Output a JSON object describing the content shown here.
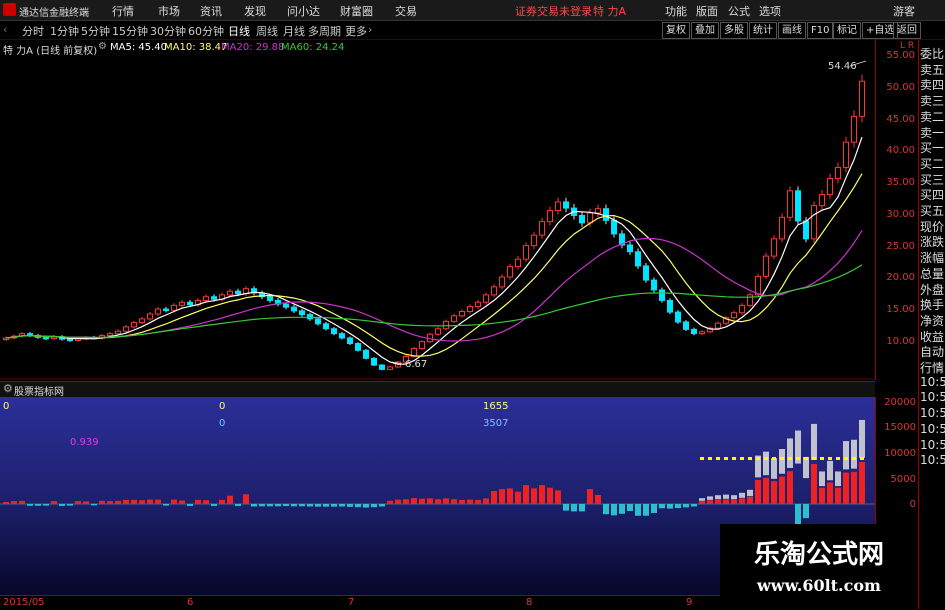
{
  "top_menu": {
    "app_title": "通达信金融终端",
    "items": [
      "行情",
      "市场",
      "资讯",
      "发现",
      "问小达",
      "财富圈",
      "交易"
    ],
    "status": "证券交易未登录",
    "stock_name": "特 力A",
    "right_items": [
      "功能",
      "版面",
      "公式",
      "选项"
    ],
    "tool": "游客"
  },
  "period_bar": {
    "periods": [
      "分时",
      "1分钟",
      "5分钟",
      "15分钟",
      "30分钟",
      "60分钟",
      "日线",
      "周线",
      "月线",
      "多周期",
      "更多"
    ],
    "active": "日线",
    "right_buttons": [
      "复权",
      "叠加",
      "多股",
      "统计",
      "画线",
      "F10",
      "标记",
      "+自选",
      "返回"
    ]
  },
  "info_line": {
    "title": "特 力A (日线 前复权)",
    "ma5": "MA5: 45.40",
    "ma10": "MA10: 38.47",
    "ma20": "MA20: 29.88",
    "ma60": "MA60: 24.24"
  },
  "price_axis": {
    "ticks": [
      "55.00",
      "50.00",
      "45.00",
      "40.00",
      "35.00",
      "30.00",
      "25.00",
      "20.00",
      "15.00",
      "10.00"
    ],
    "top_label": "L R"
  },
  "chart_annotations": {
    "high": "54.46",
    "low": "6.67"
  },
  "right_panel": {
    "items": [
      "委比",
      "卖五",
      "卖四",
      "卖三",
      "卖二",
      "卖一",
      "买一",
      "买二",
      "买三",
      "买四",
      "买五",
      "现价",
      "涨跌",
      "涨幅",
      "总量",
      "外盘",
      "换手",
      "净资",
      "收益",
      "自动",
      "行情",
      "10:5",
      "10:5",
      "10:5",
      "10:5",
      "10:5",
      "10:5"
    ]
  },
  "sub_panel": {
    "title": "股票指标网",
    "v1": "0",
    "v2": "0",
    "v3": "1655",
    "v4": "0",
    "v5": "3507",
    "v6": "0.939",
    "ticks": [
      "20000",
      "15000",
      "10000",
      "5000",
      "0"
    ]
  },
  "time_axis": {
    "labels": [
      "2015/05",
      "6",
      "7",
      "8",
      "9"
    ]
  },
  "watermark": {
    "line1": "乐淘公式网",
    "line2": "www.60lt.com"
  },
  "colors": {
    "up": "#ff3333",
    "down": "#00e5ff",
    "ma5": "#ffffff",
    "ma10": "#ffff66",
    "ma20": "#cc33cc",
    "ma60": "#33cc33",
    "axis": "#cc2222"
  },
  "chart_data": {
    "type": "candlestick",
    "ylim": [
      6,
      57
    ],
    "close": [
      12.5,
      12.8,
      13.2,
      12.9,
      12.6,
      12.4,
      12.7,
      12.3,
      12.1,
      12.4,
      12.6,
      12.5,
      12.9,
      13.2,
      13.6,
      14.3,
      15.0,
      15.6,
      16.4,
      17.2,
      17.0,
      17.8,
      18.3,
      17.9,
      18.6,
      19.2,
      18.8,
      19.5,
      20.1,
      19.7,
      20.5,
      19.8,
      19.2,
      18.6,
      18.0,
      17.5,
      16.9,
      16.3,
      15.6,
      14.8,
      14.0,
      13.2,
      12.5,
      11.6,
      10.5,
      9.2,
      8.1,
      7.4,
      7.8,
      8.6,
      9.5,
      10.8,
      11.9,
      13.1,
      14.0,
      15.2,
      16.1,
      16.8,
      17.6,
      18.3,
      19.5,
      20.8,
      22.4,
      24.1,
      25.3,
      27.5,
      29.2,
      31.4,
      33.2,
      34.6,
      33.6,
      32.4,
      31.2,
      32.8,
      33.5,
      31.6,
      29.4,
      27.6,
      26.5,
      24.2,
      21.9,
      20.3,
      18.6,
      16.7,
      15.1,
      13.9,
      13.2,
      13.5,
      14.1,
      14.9,
      15.8,
      16.6,
      17.8,
      19.5,
      22.5,
      25.8,
      28.6,
      32.1,
      36.4,
      31.5,
      28.6,
      34.0,
      35.8,
      38.4,
      40.2,
      44.3,
      48.5,
      54.2
    ]
  }
}
